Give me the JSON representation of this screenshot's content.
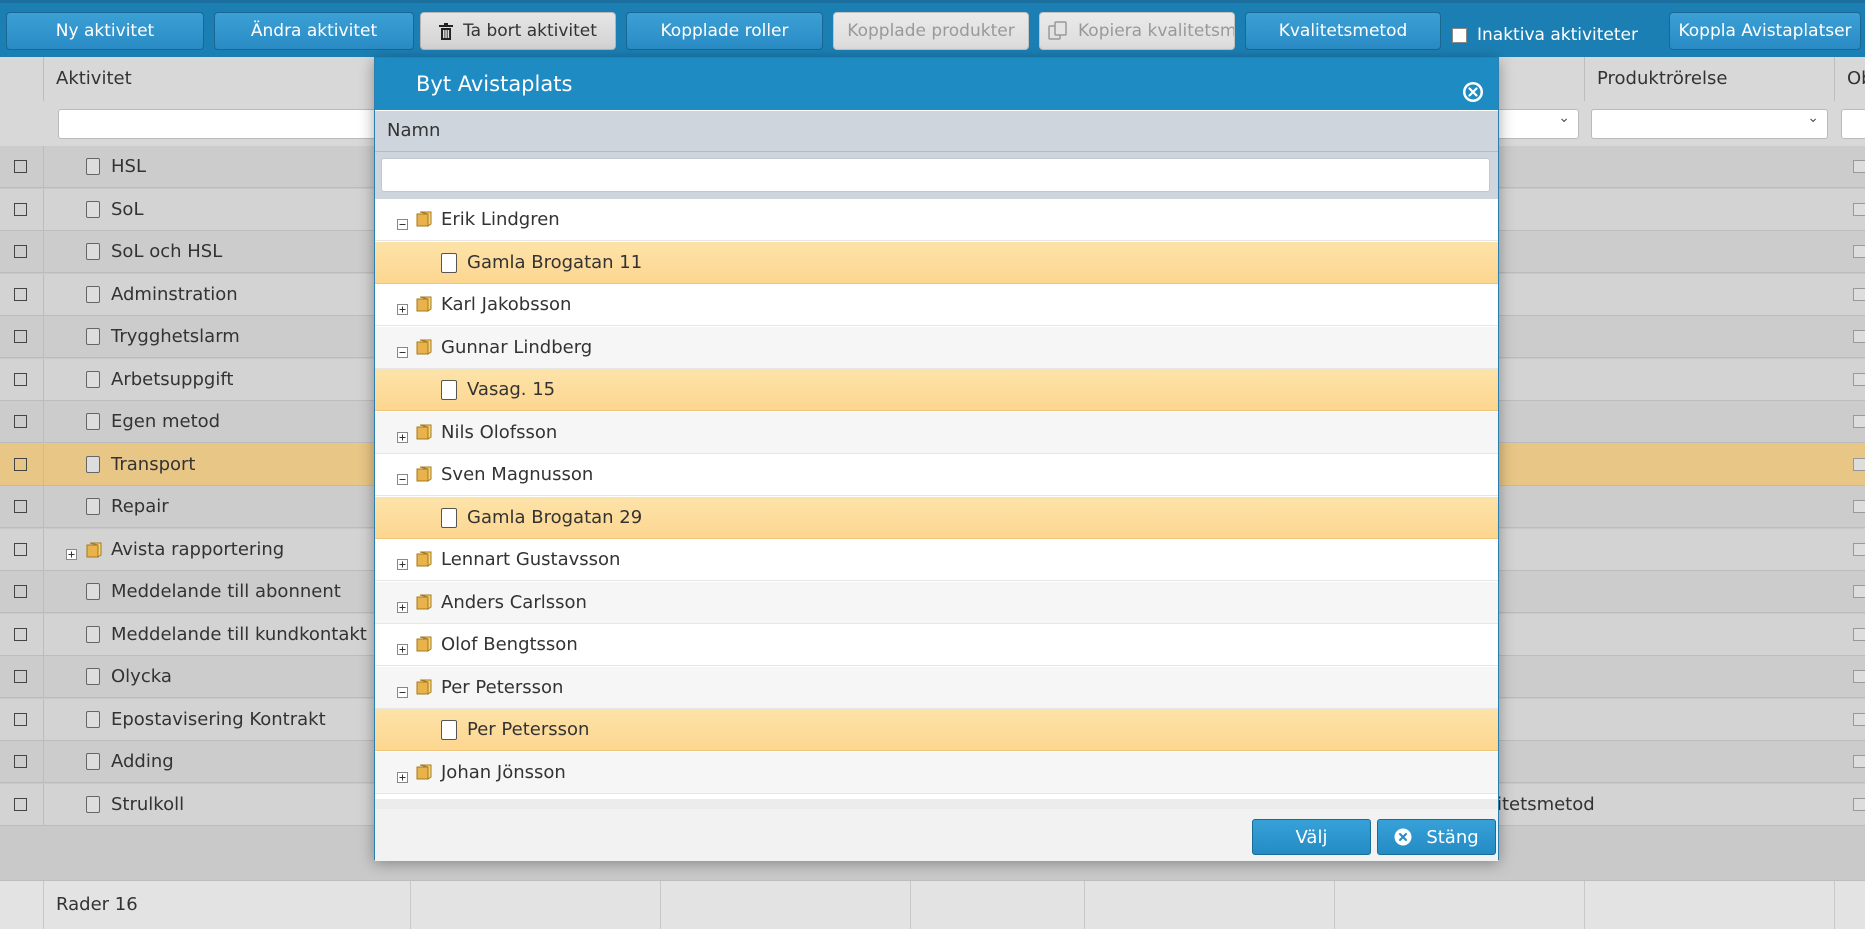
{
  "toolbar": {
    "new_activity": "Ny aktivitet",
    "edit_activity": "Ändra aktivitet",
    "delete_activity": "Ta bort aktivitet",
    "linked_roles": "Kopplade roller",
    "linked_products": "Kopplade produkter",
    "copy_quality": "Kopiera kvalitetsmet",
    "quality_method": "Kvalitetsmetod",
    "inactive_label": "Inaktiva aktiviteter",
    "link_places": "Koppla Avistaplatser"
  },
  "grid": {
    "col_activity": "Aktivitet",
    "col_product_move": "Produktrörelse",
    "col_partial": "Ob",
    "rows": [
      {
        "label": "HSL",
        "type": "file"
      },
      {
        "label": "SoL",
        "type": "file"
      },
      {
        "label": "SoL och HSL",
        "type": "file"
      },
      {
        "label": "Adminstration",
        "type": "file"
      },
      {
        "label": "Trygghetslarm",
        "type": "file"
      },
      {
        "label": "Arbetsuppgift",
        "type": "file"
      },
      {
        "label": "Egen metod",
        "type": "file"
      },
      {
        "label": "Transport",
        "type": "file"
      },
      {
        "label": "Repair",
        "type": "file"
      },
      {
        "label": "Avista rapportering",
        "type": "folder"
      },
      {
        "label": "Meddelande till abonnent",
        "type": "file"
      },
      {
        "label": "Meddelande till kundkontakt",
        "type": "file"
      },
      {
        "label": "Olycka",
        "type": "file"
      },
      {
        "label": "Epostavisering Kontrakt",
        "type": "file"
      },
      {
        "label": "Adding",
        "type": "file"
      },
      {
        "label": "Strulkoll",
        "type": "file"
      }
    ],
    "last_row_extra": "itetsmetod",
    "footer_rows": "Rader 16"
  },
  "modal": {
    "title": "Byt Avistaplats",
    "column": "Namn",
    "tree": [
      {
        "label": "Erik Lindgren",
        "kind": "parent",
        "expanded": true
      },
      {
        "label": "Gamla Brogatan 11",
        "kind": "child"
      },
      {
        "label": "Karl Jakobsson",
        "kind": "parent",
        "expanded": false
      },
      {
        "label": "Gunnar Lindberg",
        "kind": "parent",
        "expanded": true
      },
      {
        "label": "Vasag. 15",
        "kind": "child"
      },
      {
        "label": "Nils Olofsson",
        "kind": "parent",
        "expanded": false
      },
      {
        "label": "Sven Magnusson",
        "kind": "parent",
        "expanded": true
      },
      {
        "label": "Gamla Brogatan 29",
        "kind": "child"
      },
      {
        "label": "Lennart Gustavsson",
        "kind": "parent",
        "expanded": false
      },
      {
        "label": "Anders Carlsson",
        "kind": "parent",
        "expanded": false
      },
      {
        "label": "Olof Bengtsson",
        "kind": "parent",
        "expanded": false
      },
      {
        "label": "Per Petersson",
        "kind": "parent",
        "expanded": true
      },
      {
        "label": "Per Petersson",
        "kind": "child"
      },
      {
        "label": "Johan Jönsson",
        "kind": "parent",
        "expanded": false
      }
    ],
    "select_button": "Välj",
    "close_button": "Stäng"
  }
}
